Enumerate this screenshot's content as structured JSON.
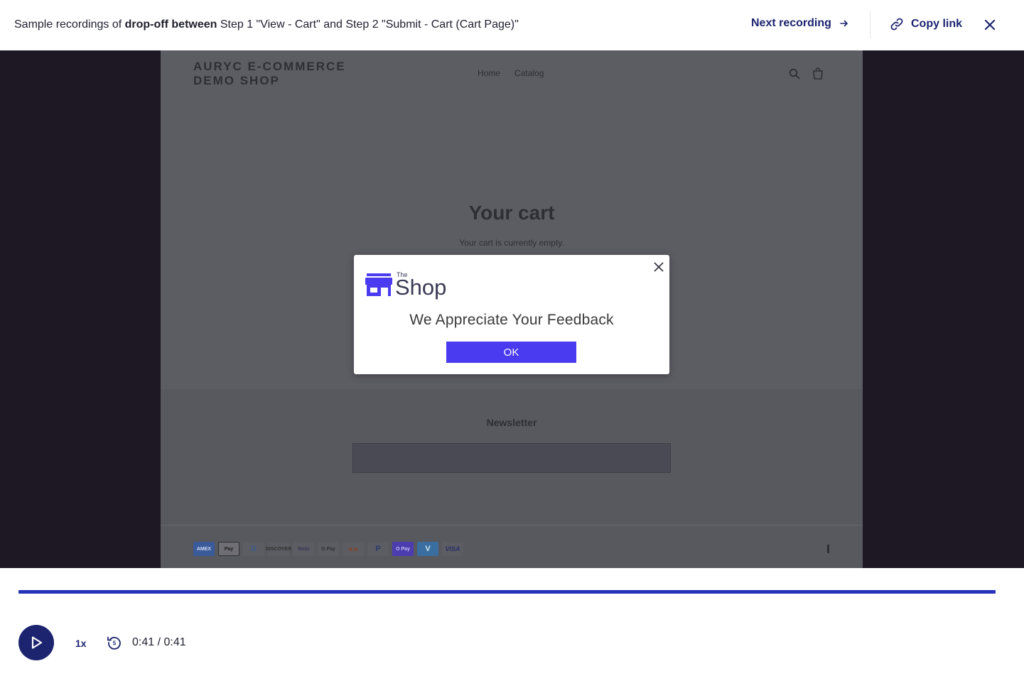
{
  "header": {
    "title_prefix": "Sample recordings of ",
    "title_bold": "drop-off between",
    "title_suffix": " Step 1 \"View - Cart\" and Step 2 \"Submit - Cart (Cart Page)\"",
    "next_label": "Next recording",
    "copy_label": "Copy link",
    "icons": {
      "next": "arrow-right-icon",
      "copy": "link-icon",
      "close": "close-icon"
    }
  },
  "site": {
    "brand_line1": "AURYC E-COMMERCE",
    "brand_line2": "DEMO SHOP",
    "nav": [
      "Home",
      "Catalog"
    ],
    "cart_title": "Your cart",
    "cart_empty": "Your cart is currently empty.",
    "newsletter": "Newsletter",
    "payments": [
      "AMEX",
      "Pay",
      "D",
      "DISCOVER",
      "Meta",
      "G Pay",
      "●●",
      "P",
      "O Pay",
      "V",
      "VISA"
    ]
  },
  "modal": {
    "logo_the": "The",
    "logo_word": "Shop",
    "message": "We Appreciate Your Feedback",
    "ok_label": "OK",
    "brand_color": "#4a3bf0"
  },
  "player": {
    "speed": "1x",
    "time": "0:41 / 0:41",
    "progress": 1.0,
    "accent": "#1c2470",
    "progress_color": "#2531b8"
  }
}
